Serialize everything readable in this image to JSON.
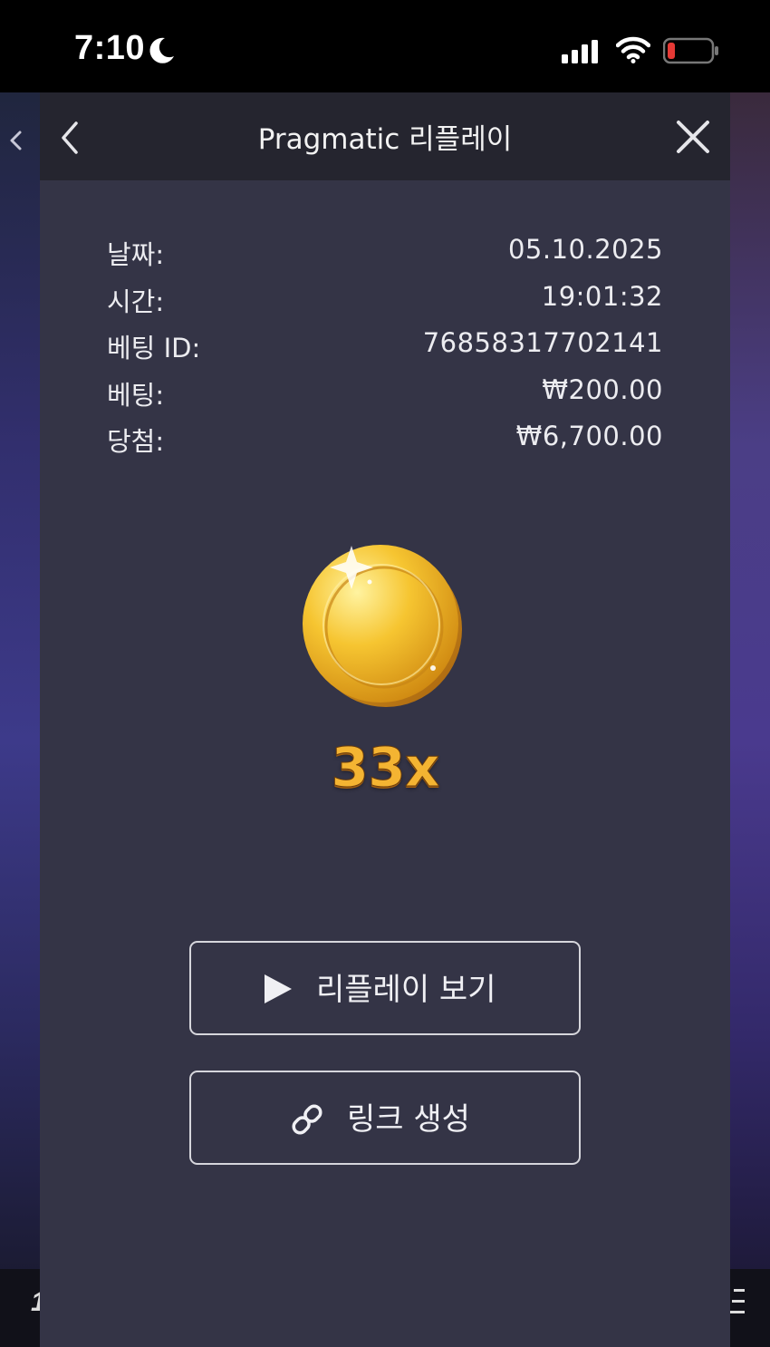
{
  "status_bar": {
    "time": "7:10",
    "icons": [
      "moon-icon",
      "cellular-signal-icon",
      "wifi-icon",
      "battery-low-icon"
    ]
  },
  "background_game": {
    "bottom_left_number": "1"
  },
  "modal": {
    "title": "Pragmatic 리플레이",
    "rows": [
      {
        "label": "날짜:",
        "value": "05.10.2025"
      },
      {
        "label": "시간:",
        "value": "19:01:32"
      },
      {
        "label": "베팅 ID:",
        "value": "76858317702141"
      },
      {
        "label": "베팅:",
        "value": "₩200.00"
      },
      {
        "label": "당첨:",
        "value": "₩6,700.00"
      }
    ],
    "symbol_icon": "gold-coin-icon",
    "multiplier": "33x",
    "buttons": {
      "replay": "리플레이 보기",
      "link": "링크 생성"
    }
  },
  "colors": {
    "modal_bg": "#343446",
    "header_bg": "#25252f",
    "multiplier_gold": "#f4b432",
    "battery_red": "#e53935"
  }
}
